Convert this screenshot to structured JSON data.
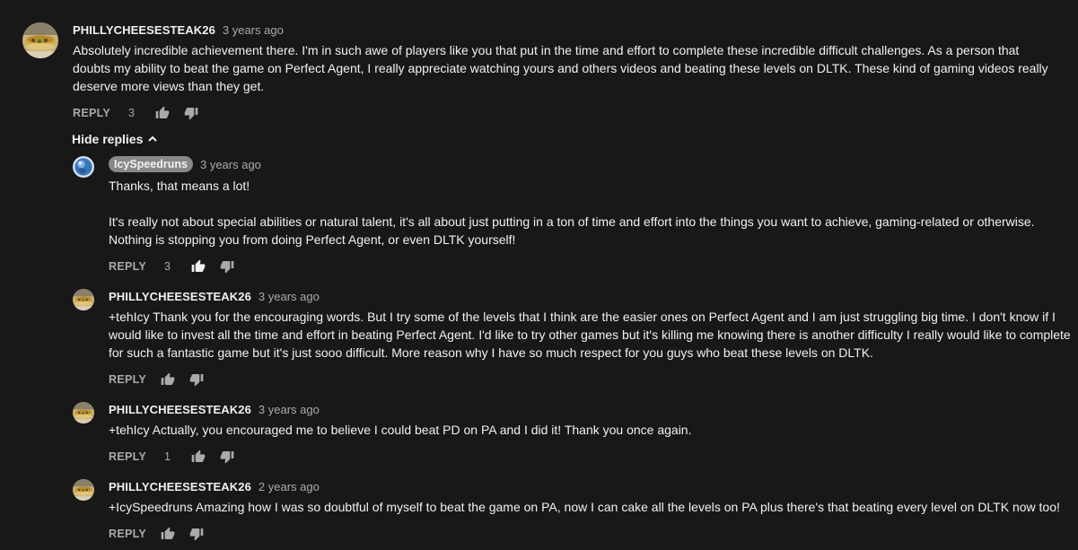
{
  "top_comment": {
    "author": "PHILLYCHEESESTEAK26",
    "time": "3 years ago",
    "text": "Absolutely incredible achievement there. I'm in such awe of players like you that put in the time and effort to complete these incredible difficult challenges. As a person that doubts my ability to beat the game on Perfect Agent, I really appreciate watching yours and others videos and beating these levels on DLTK. These kind of gaming videos really deserve more views than they get.",
    "reply_label": "REPLY",
    "likes": "3"
  },
  "hide_replies_label": "Hide replies",
  "replies": [
    {
      "author": "IcySpeedruns",
      "time": "3 years ago",
      "text": "Thanks, that means a lot!\n\nIt's really not about special abilities or natural talent, it's all about just putting in a ton of time and effort into the things you want to achieve, gaming-related or otherwise. Nothing is stopping you from doing Perfect Agent, or even DLTK yourself!",
      "reply_label": "REPLY",
      "likes": "3"
    },
    {
      "author": "PHILLYCHEESESTEAK26",
      "time": "3 years ago",
      "text": "+tehIcy Thank you for the encouraging words. But I try some of the levels that I think are the easier ones on Perfect Agent and I am just struggling big time. I don't know if I would like to invest all the time and effort in beating Perfect Agent. I'd like to try other games but it's killing me knowing there is another difficulty I really would like to complete for such a fantastic game but it's just sooo difficult. More reason why I have so much respect for you guys who beat these levels on DLTK.",
      "reply_label": "REPLY",
      "likes": ""
    },
    {
      "author": "PHILLYCHEESESTEAK26",
      "time": "3 years ago",
      "text": "+tehIcy Actually, you encouraged me to believe I could beat PD on PA and I did it! Thank you once again.",
      "reply_label": "REPLY",
      "likes": "1"
    },
    {
      "author": "PHILLYCHEESESTEAK26",
      "time": "2 years ago",
      "text": "+IcySpeedruns Amazing how I was so doubtful of myself to beat the game on PA, now I can cake all the levels on PA plus there's that beating every level on DLTK now too!",
      "reply_label": "REPLY",
      "likes": ""
    }
  ],
  "icons": {
    "like": "thumbs-up-icon",
    "dislike": "thumbs-down-icon",
    "collapse": "chevron-up-icon"
  },
  "colors": {
    "background": "#181818",
    "text": "#f1f1f1",
    "secondary": "#aaaaaa",
    "author_chip": "#888888"
  }
}
